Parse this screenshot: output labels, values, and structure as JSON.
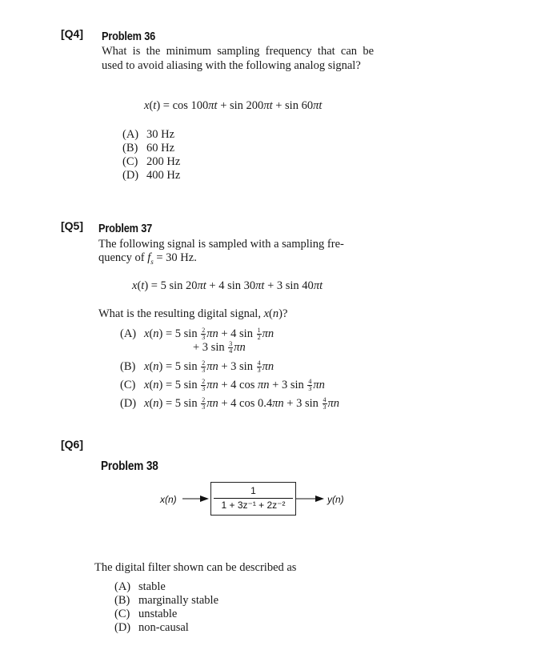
{
  "questions": [
    {
      "tag": "[Q4]",
      "problem_title": "Problem 36",
      "prompt": "What is the minimum sampling frequency that can be used to avoid aliasing with the following analog signal?",
      "equation": "x(t) = cos 100πt + sin 200πt + sin 60πt",
      "options": [
        {
          "label": "(A)",
          "text": "30 Hz"
        },
        {
          "label": "(B)",
          "text": "60 Hz"
        },
        {
          "label": "(C)",
          "text": "200 Hz"
        },
        {
          "label": "(D)",
          "text": "400 Hz"
        }
      ]
    },
    {
      "tag": "[Q5]",
      "problem_title": "Problem 37",
      "prompt_line1": "The following signal is sampled with a sampling fre-",
      "prompt_line2_prefix": "quency of ",
      "prompt_line2_var": "f",
      "prompt_line2_sub": "s",
      "prompt_line2_suffix": " = 30 Hz.",
      "equation": "x(t) = 5 sin 20πt + 4 sin 30πt + 3 sin 40πt",
      "question": "What is the resulting digital signal, x(n)?",
      "options": [
        {
          "label": "(A)",
          "text": "x(n) = 5 sin (2/3)πn + 4 sin (1/2)πn + 3 sin (3/4)πn"
        },
        {
          "label": "(B)",
          "text": "x(n) = 5 sin (2/3)πn + 3 sin (4/3)πn"
        },
        {
          "label": "(C)",
          "text": "x(n) = 5 sin (2/3)πn + 4 cos πn + 3 sin (4/3)πn"
        },
        {
          "label": "(D)",
          "text": "x(n) = 5 sin (2/3)πn + 4 cos 0.4πn + 3 sin (4/3)πn"
        }
      ]
    },
    {
      "tag": "[Q6]",
      "problem_title": "Problem 38",
      "diagram": {
        "input": "x(n)",
        "output": "y(n)",
        "numerator": "1",
        "denominator": "1 + 3z⁻¹ + 2z⁻²"
      },
      "prompt": "The digital filter shown can be described as",
      "options": [
        {
          "label": "(A)",
          "text": "stable"
        },
        {
          "label": "(B)",
          "text": "marginally stable"
        },
        {
          "label": "(C)",
          "text": "unstable"
        },
        {
          "label": "(D)",
          "text": "non-causal"
        }
      ]
    }
  ]
}
